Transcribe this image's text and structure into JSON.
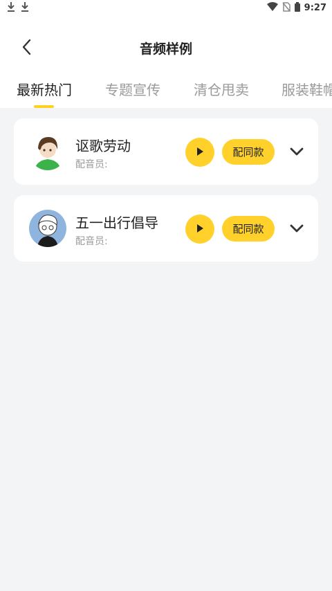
{
  "status_bar": {
    "time": "9:27",
    "left_icons": [
      "download-icon",
      "download-icon"
    ],
    "right_icons": [
      "wifi-icon",
      "no-sim-icon",
      "battery-icon"
    ]
  },
  "header": {
    "title": "音频样例",
    "back_icon": "back-arrow-icon"
  },
  "tabs": [
    {
      "label": "最新热门",
      "active": true
    },
    {
      "label": "专题宣传",
      "active": false
    },
    {
      "label": "清仓甩卖",
      "active": false
    },
    {
      "label": "服装鞋帽",
      "active": false
    }
  ],
  "colors": {
    "accent": "#ffd12a",
    "background": "#f3f4f6",
    "card": "#ffffff",
    "text_primary": "#222222",
    "text_secondary": "#9a9a9a"
  },
  "items": [
    {
      "title": "讴歌劳动",
      "subtitle": "配音员:",
      "play_icon": "play-icon",
      "same_label": "配同款",
      "expand_icon": "chevron-down-icon"
    },
    {
      "title": "五一出行倡导",
      "subtitle": "配音员:",
      "play_icon": "play-icon",
      "same_label": "配同款",
      "expand_icon": "chevron-down-icon"
    }
  ]
}
